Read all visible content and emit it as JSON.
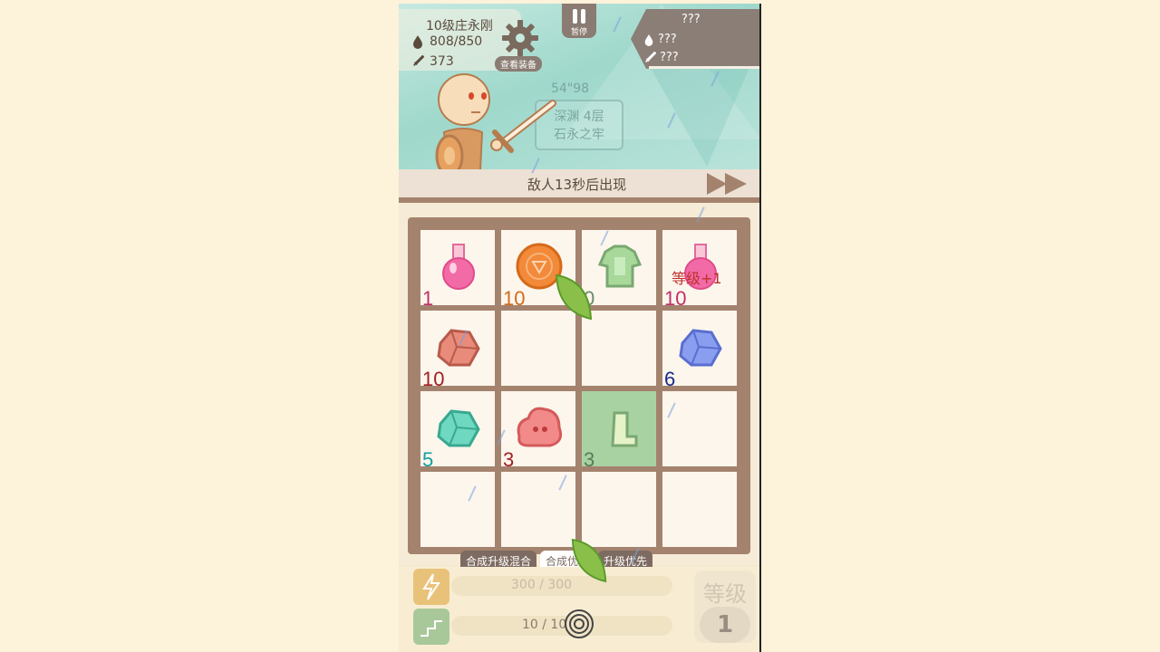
{
  "player": {
    "name": "10级庄永刚",
    "hp": "808/850",
    "attack": "373"
  },
  "equipment_label": "查看装备",
  "pause_label": "暂停",
  "enemy": {
    "name": "???",
    "hp": "???",
    "attack": "???"
  },
  "stage": {
    "timer": "54\"98",
    "floor": "深渊 4层",
    "location": "石永之牢"
  },
  "enemy_notice": "敌人13秒后出现",
  "board": {
    "cells": [
      {
        "item": "pink-potion",
        "count": "1",
        "color": "#c0306a"
      },
      {
        "item": "orange-coin",
        "count": "10",
        "color": "#d46a1a"
      },
      {
        "item": "green-armor",
        "count": "0",
        "color": "#6a8a6a"
      },
      {
        "item": "pink-potion",
        "count": "10",
        "color": "#c0306a",
        "level_up": "等级+1"
      },
      {
        "item": "red-ore",
        "count": "10",
        "color": "#a02020"
      },
      {
        "item": "",
        "count": ""
      },
      {
        "item": "",
        "count": ""
      },
      {
        "item": "blue-ore",
        "count": "6",
        "color": "#1a2a8a"
      },
      {
        "item": "teal-ore",
        "count": "5",
        "color": "#13a0a0"
      },
      {
        "item": "red-slime",
        "count": "3",
        "color": "#a02020"
      },
      {
        "item": "green-boot",
        "count": "3",
        "color": "#5a7a5a"
      },
      {
        "item": "",
        "count": ""
      },
      {
        "item": "",
        "count": ""
      },
      {
        "item": "",
        "count": ""
      },
      {
        "item": "",
        "count": ""
      },
      {
        "item": "",
        "count": ""
      }
    ]
  },
  "tabs": [
    {
      "label": "合成升级混合"
    },
    {
      "label": "合成优先"
    },
    {
      "label": "升级优先"
    }
  ],
  "energy": {
    "text": "300 / 300",
    "fill": 1.0
  },
  "stairs": {
    "text": "10 / 10",
    "fill": 1.0
  },
  "level": {
    "label": "等级",
    "value": "1"
  }
}
